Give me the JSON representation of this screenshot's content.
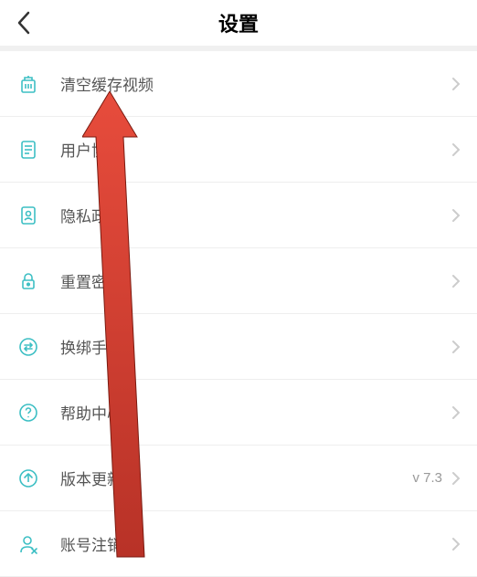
{
  "header": {
    "title": "设置"
  },
  "items": [
    {
      "label": "清空缓存视频",
      "icon": "trash-icon",
      "value": ""
    },
    {
      "label": "用户协议",
      "icon": "doc-icon",
      "value": ""
    },
    {
      "label": "隐私政策",
      "icon": "privacy-icon",
      "value": ""
    },
    {
      "label": "重置密码",
      "icon": "lock-icon",
      "value": ""
    },
    {
      "label": "换绑手机",
      "icon": "swap-icon",
      "value": ""
    },
    {
      "label": "帮助中心",
      "icon": "help-icon",
      "value": ""
    },
    {
      "label": "版本更新",
      "icon": "update-icon",
      "value": "v 7.3"
    },
    {
      "label": "账号注销",
      "icon": "user-x-icon",
      "value": ""
    }
  ],
  "colors": {
    "accent": "#3dbfc4",
    "arrow": "#e74c3c"
  }
}
